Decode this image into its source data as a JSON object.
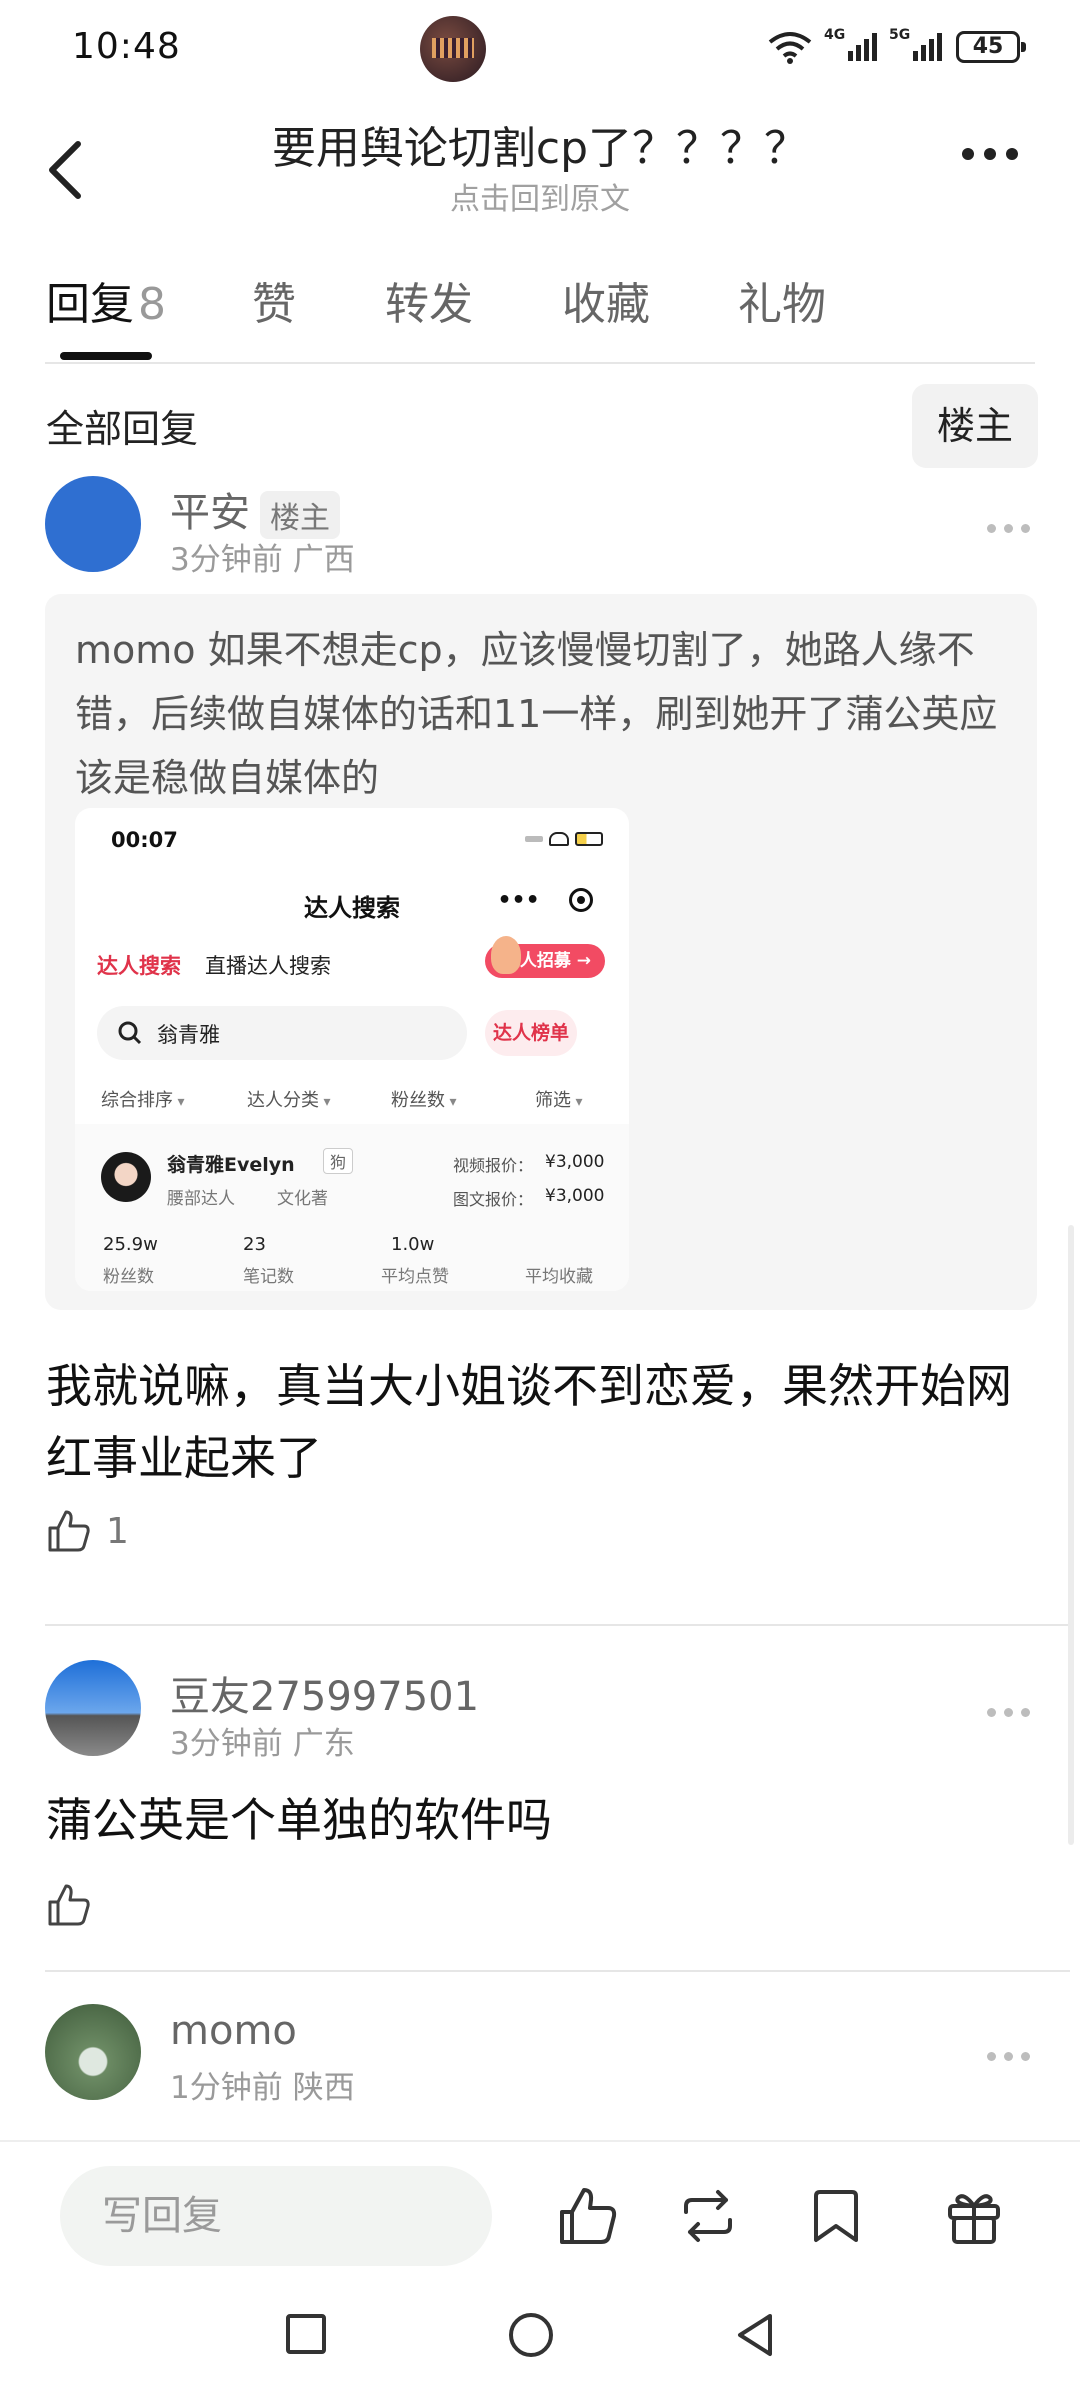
{
  "status_bar": {
    "time": "10:48",
    "signal1_label": "4G",
    "signal2_label": "5G",
    "battery": "45"
  },
  "header": {
    "title": "要用舆论切割cp了？？？？",
    "subtitle": "点击回到原文"
  },
  "tabs": [
    {
      "label": "回复",
      "count": "8"
    },
    {
      "label": "赞"
    },
    {
      "label": "转发"
    },
    {
      "label": "收藏"
    },
    {
      "label": "礼物"
    }
  ],
  "section": {
    "title": "全部回复",
    "filter_label": "楼主"
  },
  "comments": [
    {
      "author": "平安",
      "badge": "楼主",
      "time": "3分钟前",
      "location": "广西",
      "quote": "momo 如果不想走cp，应该慢慢切割了，她路人缘不错，后续做自媒体的话和11一样，刷到她开了蒲公英应该是稳做自媒体的",
      "text": "我就说嘛，真当大小姐谈不到恋爱，果然开始网红事业起来了",
      "likes": "1",
      "avatar_color": "#2f6fd1"
    },
    {
      "author": "豆友275997501",
      "time": "3分钟前",
      "location": "广东",
      "text": "蒲公英是个单独的软件吗",
      "likes": ""
    },
    {
      "author": "momo",
      "time": "1分钟前",
      "location": "陕西"
    }
  ],
  "embedded_screenshot": {
    "time": "00:07",
    "title": "达人搜索",
    "tab_active": "达人搜索",
    "tab_other": "直播达人搜索",
    "recruit_button": "达人招募 →",
    "search_value": "翁青雅",
    "rank_button": "达人榜单",
    "filters": [
      "综合排序",
      "达人分类",
      "粉丝数",
      "筛选"
    ],
    "result": {
      "name": "翁青雅Evelyn",
      "tag": "狗",
      "sub1": "腰部达人",
      "sub2": "文化著",
      "video_price_label": "视频报价：",
      "video_price": "¥3,000",
      "image_price_label": "图文报价：",
      "image_price": "¥3,000",
      "stats": [
        {
          "value": "25.9w",
          "label": "粉丝数"
        },
        {
          "value": "23",
          "label": "笔记数"
        },
        {
          "value": "1.0w",
          "label": "平均点赞"
        },
        {
          "value": "",
          "label": "平均收藏"
        }
      ]
    }
  },
  "bottom_bar": {
    "reply_placeholder": "写回复"
  },
  "icons": [
    "back-icon",
    "more-icon",
    "thumb-up-icon",
    "repost-icon",
    "bookmark-icon",
    "gift-icon",
    "nav-square-icon",
    "nav-home-icon",
    "nav-back-icon"
  ]
}
